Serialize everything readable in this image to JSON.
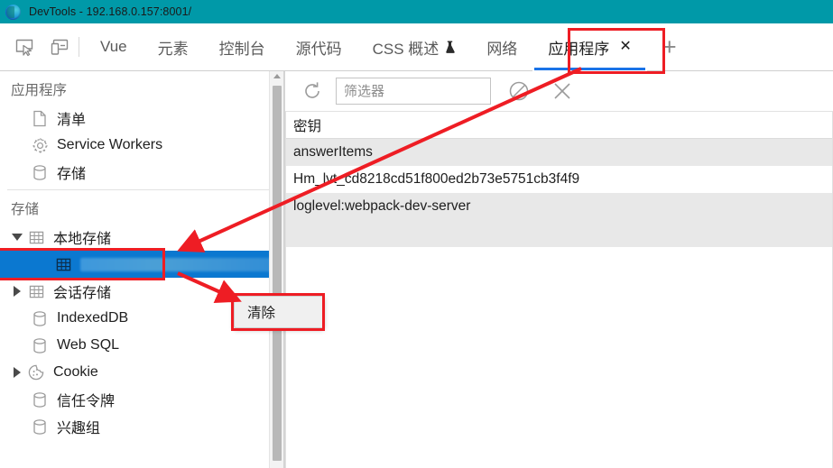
{
  "window": {
    "title": "DevTools - 192.168.0.157:8001/",
    "logo_icon": "edge-logo-icon",
    "titlebar_color": "#0099a8"
  },
  "toolbar": {
    "inspect_icon": "inspect-element-icon",
    "device_icon": "device-toolbar-icon",
    "add_tab_label": "+",
    "tabs": [
      {
        "label": "Vue",
        "active": false
      },
      {
        "label": "元素",
        "active": false
      },
      {
        "label": "控制台",
        "active": false
      },
      {
        "label": "源代码",
        "active": false
      },
      {
        "label": "CSS 概述",
        "active": false,
        "icon": "flask-experiment-icon"
      },
      {
        "label": "网络",
        "active": false
      },
      {
        "label": "应用程序",
        "active": true,
        "close_label": "✕"
      }
    ]
  },
  "sidebar": {
    "application": {
      "title": "应用程序",
      "items": [
        {
          "label": "清单",
          "icon": "manifest-document-icon"
        },
        {
          "label": "Service Workers",
          "icon": "gear-icon"
        },
        {
          "label": "存储",
          "icon": "database-icon"
        }
      ]
    },
    "storage": {
      "title": "存储",
      "items": [
        {
          "label": "本地存储",
          "icon": "table-grid-icon",
          "twisty": "down",
          "expanded": true,
          "highlighted": true
        },
        {
          "label": "",
          "icon": "table-grid-icon",
          "selected": true,
          "redacted": true
        },
        {
          "label": "会话存储",
          "icon": "table-grid-icon",
          "twisty": "right",
          "expanded": false
        },
        {
          "label": "IndexedDB",
          "icon": "database-icon"
        },
        {
          "label": "Web SQL",
          "icon": "database-icon"
        },
        {
          "label": "Cookie",
          "icon": "cookie-icon",
          "twisty": "right",
          "expanded": false
        },
        {
          "label": "信任令牌",
          "icon": "database-icon"
        },
        {
          "label": "兴趣组",
          "icon": "database-icon"
        }
      ]
    }
  },
  "main": {
    "toolbar": {
      "refresh_icon": "refresh-icon",
      "filter_placeholder": "筛选器",
      "filter_value": "",
      "clear_icon": "no-entry-clear-icon",
      "delete_icon": "close-x-icon"
    },
    "table": {
      "columns": [
        "密钥"
      ],
      "rows": [
        {
          "key": "answerItems"
        },
        {
          "key": "Hm_lvt_cd8218cd51f800ed2b73e5751cb3f4f9"
        },
        {
          "key": "loglevel:webpack-dev-server"
        }
      ]
    }
  },
  "context_menu": {
    "items": [
      {
        "label": "清除"
      }
    ]
  },
  "annotations": {
    "color": "#ee1d24",
    "boxes": [
      "应用程序 tab",
      "本地存储 tree item",
      "清除 context menu item"
    ],
    "arrows": 2
  }
}
